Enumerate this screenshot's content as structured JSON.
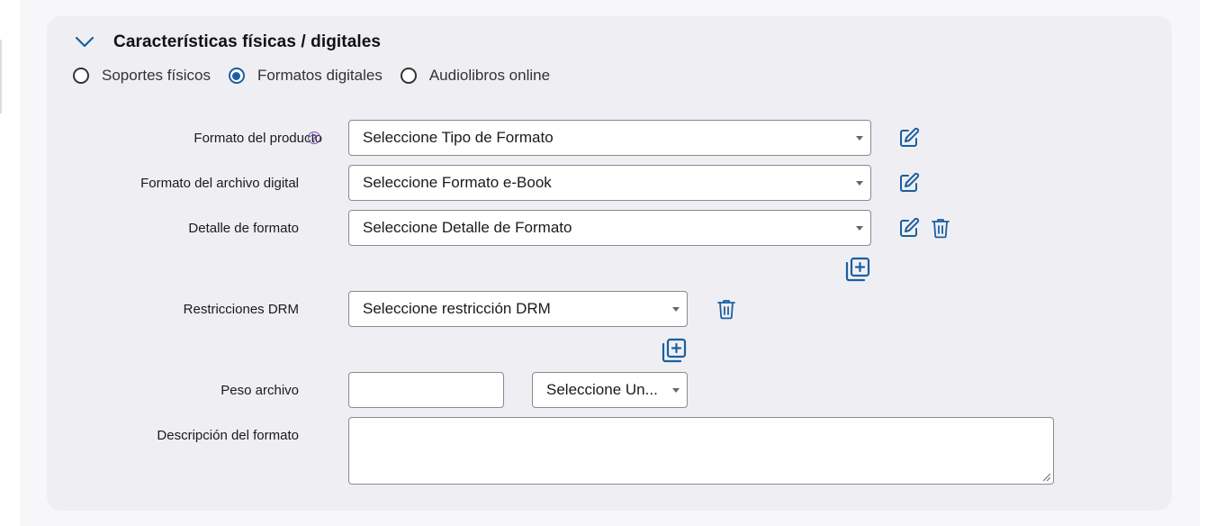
{
  "section": {
    "title": "Características físicas / digitales",
    "expanded_icon": "chevron-down-icon"
  },
  "radios": [
    {
      "label": "Soportes físicos",
      "checked": false
    },
    {
      "label": "Formatos digitales",
      "checked": true
    },
    {
      "label": "Audiolibros online",
      "checked": false
    }
  ],
  "fields": {
    "formato_producto": {
      "label": "Formato del producto",
      "value": "Seleccione Tipo de Formato",
      "help": "?"
    },
    "formato_archivo": {
      "label": "Formato del archivo digital",
      "value": "Seleccione Formato e-Book"
    },
    "detalle_formato": {
      "label": "Detalle de formato",
      "value": "Seleccione Detalle de Formato"
    },
    "restricciones_drm": {
      "label": "Restricciones DRM",
      "value": "Seleccione restricción DRM"
    },
    "peso_archivo": {
      "label": "Peso archivo",
      "value": "",
      "unit_value": "Seleccione Un..."
    },
    "descripcion_formato": {
      "label": "Descripción del formato",
      "value": ""
    }
  },
  "colors": {
    "accent": "#1a5fa0",
    "help": "#7b4fb0",
    "panel": "#efeff3",
    "background": "#f7f7f9"
  },
  "icons": [
    "edit-icon",
    "trash-icon",
    "add-copy-icon",
    "help-icon",
    "chevron-down-icon"
  ]
}
